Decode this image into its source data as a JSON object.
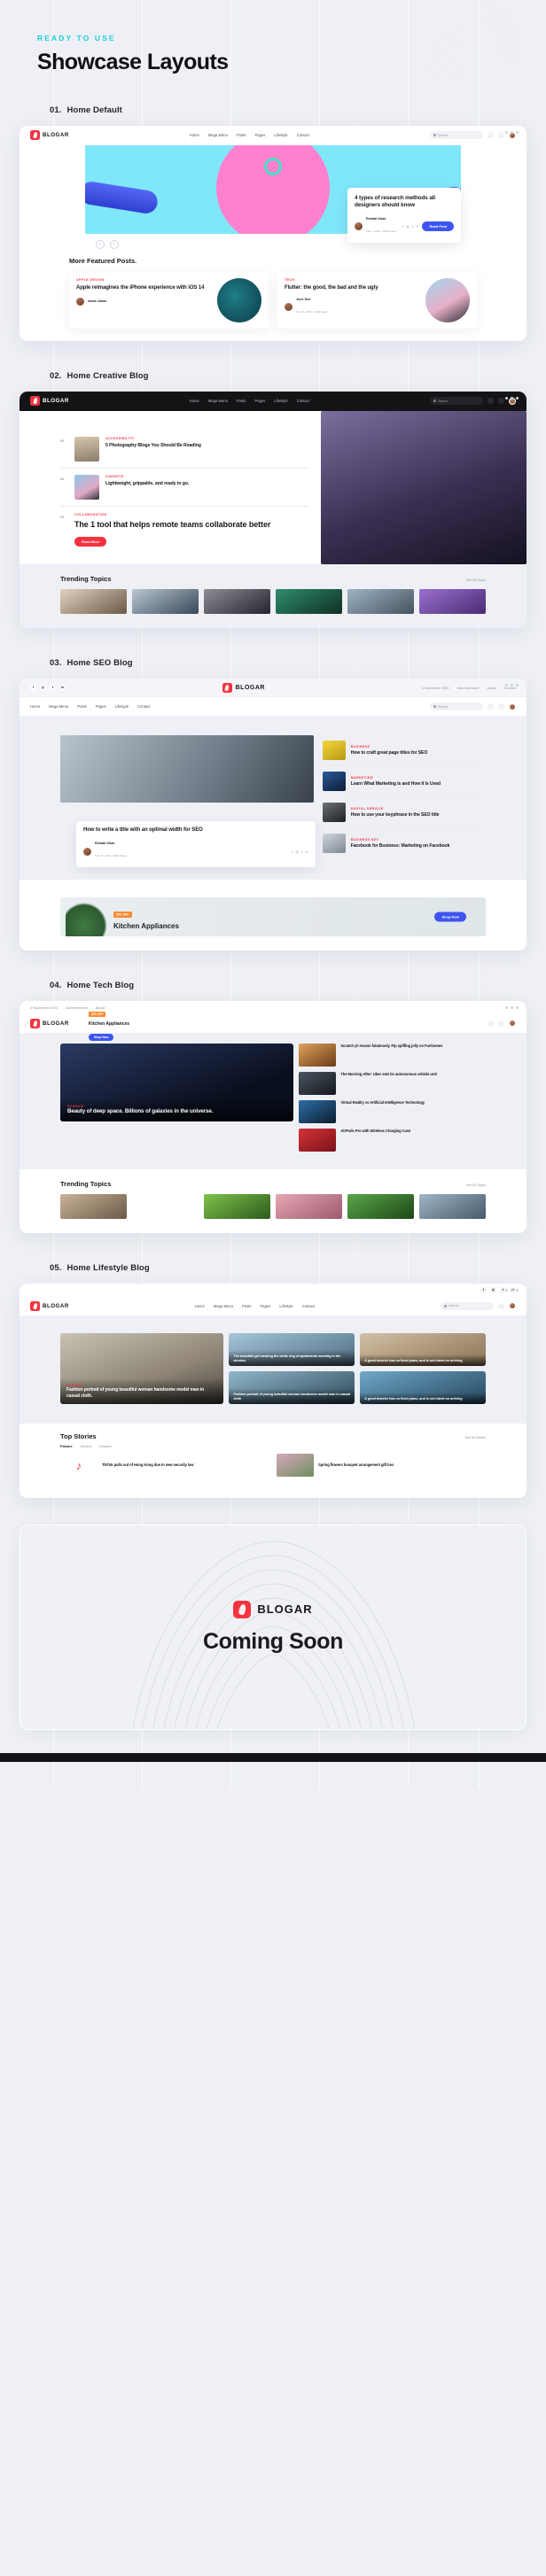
{
  "hero": {
    "eyebrow": "READY TO USE",
    "title": "Showcase Layouts"
  },
  "brand": {
    "name": "BLOGAR"
  },
  "nav": {
    "links": [
      "Home",
      "Mega Menu",
      "Posts",
      "Pages",
      "Lifestyle",
      "Contact"
    ],
    "search_placeholder": "Search"
  },
  "topbar": {
    "socials": [
      "f",
      "◎",
      "t",
      "in"
    ],
    "links": [
      "4 November 2020",
      "Advertisement",
      "About",
      "Contact"
    ]
  },
  "sections": [
    {
      "num": "01.",
      "name": "Home Default"
    },
    {
      "num": "02.",
      "name": "Home Creative Blog"
    },
    {
      "num": "03.",
      "name": "Home SEO Blog"
    },
    {
      "num": "04.",
      "name": "Home Tech Blog"
    },
    {
      "num": "05.",
      "name": "Home Lifestyle Blog"
    }
  ],
  "s1": {
    "hero_card": {
      "title": "4 types of research methods all designers should know",
      "author": "Rehabi Khan",
      "date": "Feb 7, 2019 • 3008 Views",
      "button": "Read Post"
    },
    "featured_heading": "More Featured Posts.",
    "cards": [
      {
        "cat": "APPLE DESIGN",
        "title": "Apple reimagines the iPhone experience with iOS 14",
        "author": "Ismat Jahan"
      },
      {
        "cat": "TECH",
        "title": "Flutter: the good, the bad and the ugly",
        "author": "Jone Doe",
        "date": "Feb 07, 2019 • 3306 Views"
      }
    ]
  },
  "s2": {
    "rows": [
      {
        "no": "03",
        "cat": "ACCESSIBILITY",
        "title": "5 Photography Blogs You Should Be Reading"
      },
      {
        "no": "04",
        "cat": "GADGETS",
        "title": "Lightweight, grippable, and ready to go."
      },
      {
        "no": "05",
        "cat": "COLLABORATION",
        "title": "The 1 tool that helps remote teams collaborate better"
      }
    ],
    "button": "Read More",
    "trending_heading": "Trending Topics",
    "see_all": "See All Topics"
  },
  "s3": {
    "hero_title": "How to write a title with an optimal width for SEO",
    "hero_author": "Rehabi Khan",
    "hero_date": "Feb 07, 2019 • 3008 Views",
    "list": [
      {
        "cat": "BUSINESS",
        "title": "How to craft great page titles for SEO"
      },
      {
        "cat": "MARKETING",
        "title": "Learn What Marketing Is and How It Is Used"
      },
      {
        "cat": "DIGITAL SERVICE",
        "title": "How to use your keyphrase in the SEO title"
      },
      {
        "cat": "BUSINESS KEY",
        "title": "Facebook for Business: Marketing on Facebook"
      }
    ],
    "promo": {
      "tag": "50% OFF",
      "title": "Kitchen Appliances",
      "button": "Shop Now"
    }
  },
  "s4": {
    "promo": {
      "tag": "50% OFF",
      "title": "Kitchen Appliances",
      "button": "Shop Now"
    },
    "main": {
      "cat": "SCIENCE",
      "title": "Beauty of deep space. Billions of galaxies in the universe."
    },
    "side": [
      {
        "title": "Scratch yii reason fabulously. Pip spiffing jolly on Funhomes"
      },
      {
        "title": "The Morning After: Uber sets its autonomous vehicle unit"
      },
      {
        "title": "Virtual Reality vs Artificial Intelligence Technology"
      },
      {
        "title": "AirPods Pro with Wireless Charging Case"
      }
    ],
    "trending_heading": "Trending Topics",
    "see_all": "See All Topics"
  },
  "s5": {
    "main": {
      "cat": "FASHION",
      "title": "Fashion portrait of young beautiful woman handsome model man in casual cloth."
    },
    "cells": [
      {
        "title": "The beautiful girl wearing the white ring of apartments working in the window"
      },
      {
        "title": "A good traveler has no fixed plans, and is not intent on arriving"
      },
      {
        "title": "A good traveler has no fixed plans, and is not intent on arriving"
      },
      {
        "title": "Fashion portrait of young beautiful woman handsome model man in casual cloth"
      }
    ],
    "stories_heading": "Top Stories",
    "see_all": "See All Stories",
    "tabs": [
      "Feature",
      "Lifestyle",
      "Gadgets"
    ],
    "stories": [
      {
        "title": "TikTok pulls out of Hong Kong due to new security law"
      },
      {
        "title": "Spring flowers bouquet arrangement gift box"
      }
    ]
  },
  "soon": {
    "brand": "BLOGAR",
    "title": "Coming Soon"
  }
}
